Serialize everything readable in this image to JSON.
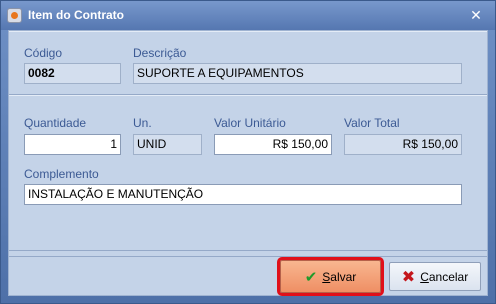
{
  "window": {
    "title": "Item do Contrato",
    "close_symbol": "✕"
  },
  "section_1": {
    "codigo_label": "Código",
    "codigo_value": "0082",
    "descricao_label": "Descrição",
    "descricao_value": "SUPORTE A EQUIPAMENTOS"
  },
  "section_2": {
    "quantidade_label": "Quantidade",
    "quantidade_value": "1",
    "un_label": "Un.",
    "un_value": "UNID",
    "valor_unitario_label": "Valor Unitário",
    "valor_unitario_value": "R$ 150,00",
    "valor_total_label": "Valor Total",
    "valor_total_value": "R$ 150,00",
    "complemento_label": "Complemento",
    "complemento_value": "INSTALAÇÃO E MANUTENÇÃO"
  },
  "footer": {
    "save_first": "S",
    "save_rest": "alvar",
    "cancel_first": "C",
    "cancel_rest": "ancelar",
    "save_icon": "check-icon",
    "cancel_icon": "x-icon",
    "save_highlight_color": "#e0101a"
  }
}
